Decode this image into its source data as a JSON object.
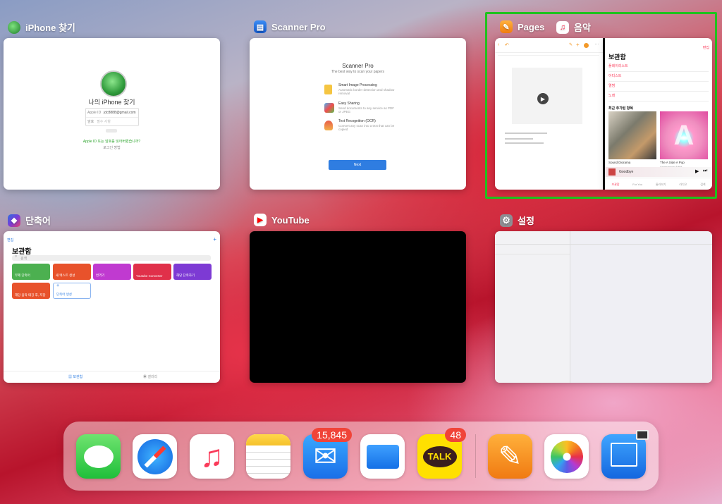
{
  "cards": {
    "findiphone": {
      "label": "iPhone 찾기",
      "title": "나의 iPhone 찾기",
      "field_apple_id_label": "Apple ID",
      "field_apple_id_value": "jdc8888@gmail.com",
      "field_password_label": "암호",
      "field_password_value": "필수 사항",
      "link_text": "Apple ID 또는 암호를 잊어버렸습니까?",
      "link2_text": "로그인 방법"
    },
    "scanner": {
      "label": "Scanner Pro",
      "title": "Scanner Pro",
      "subtitle": "The best way to scan your papers",
      "features": [
        {
          "title": "Smart Image Processing",
          "desc": "Automatic border detection and shadow removal"
        },
        {
          "title": "Easy Sharing",
          "desc": "Send documents to any service as PDF or JPEG"
        },
        {
          "title": "Text Recognition (OCR)",
          "desc": "Convert any scan into a text that can be copied"
        }
      ],
      "next_button": "Next"
    },
    "pages": {
      "label": "Pages"
    },
    "music": {
      "label": "음악",
      "edit": "편집",
      "title": "보관함",
      "menu": [
        "플레이리스트",
        "아티스트",
        "앨범",
        "노래"
      ],
      "recent_header": "최근 추가된 항목",
      "albums": [
        {
          "title": "Sound Diorama",
          "artist": ""
        },
        {
          "title": "The A Side A Pop",
          "artist": "Anonymous Artist"
        }
      ],
      "now_playing": "Goodbye",
      "tabs": [
        "보관함",
        "For You",
        "둘러보기",
        "라디오",
        "검색"
      ]
    },
    "shortcuts": {
      "label": "단축어",
      "edit": "편집",
      "title": "보관함",
      "search_placeholder": "검색",
      "tiles": [
        {
          "label": "무제 단축어",
          "color": "#4cb050"
        },
        {
          "label": "새 텍스트 생성",
          "color": "#e8522b"
        },
        {
          "label": "번역기",
          "color": "#c03ad0"
        },
        {
          "label": "Youtube Converter",
          "color": "#e0304a"
        },
        {
          "label": "해당 단축하기",
          "color": "#7d3ad4"
        },
        {
          "label": "해당 음악 태깅 후, 저장",
          "color": "#e8522b"
        },
        {
          "label": "단축어 생성",
          "color": "#ffffff"
        }
      ],
      "tab_library": "보관함",
      "tab_gallery": "갤러리"
    },
    "youtube": {
      "label": "YouTube"
    },
    "settings": {
      "label": "설정"
    }
  },
  "dock": {
    "mail_badge": "15,845",
    "kakao_badge": "48",
    "kakao_text": "TALK"
  },
  "colors": {
    "selection": "#1fc21f",
    "badge": "#f04438"
  }
}
